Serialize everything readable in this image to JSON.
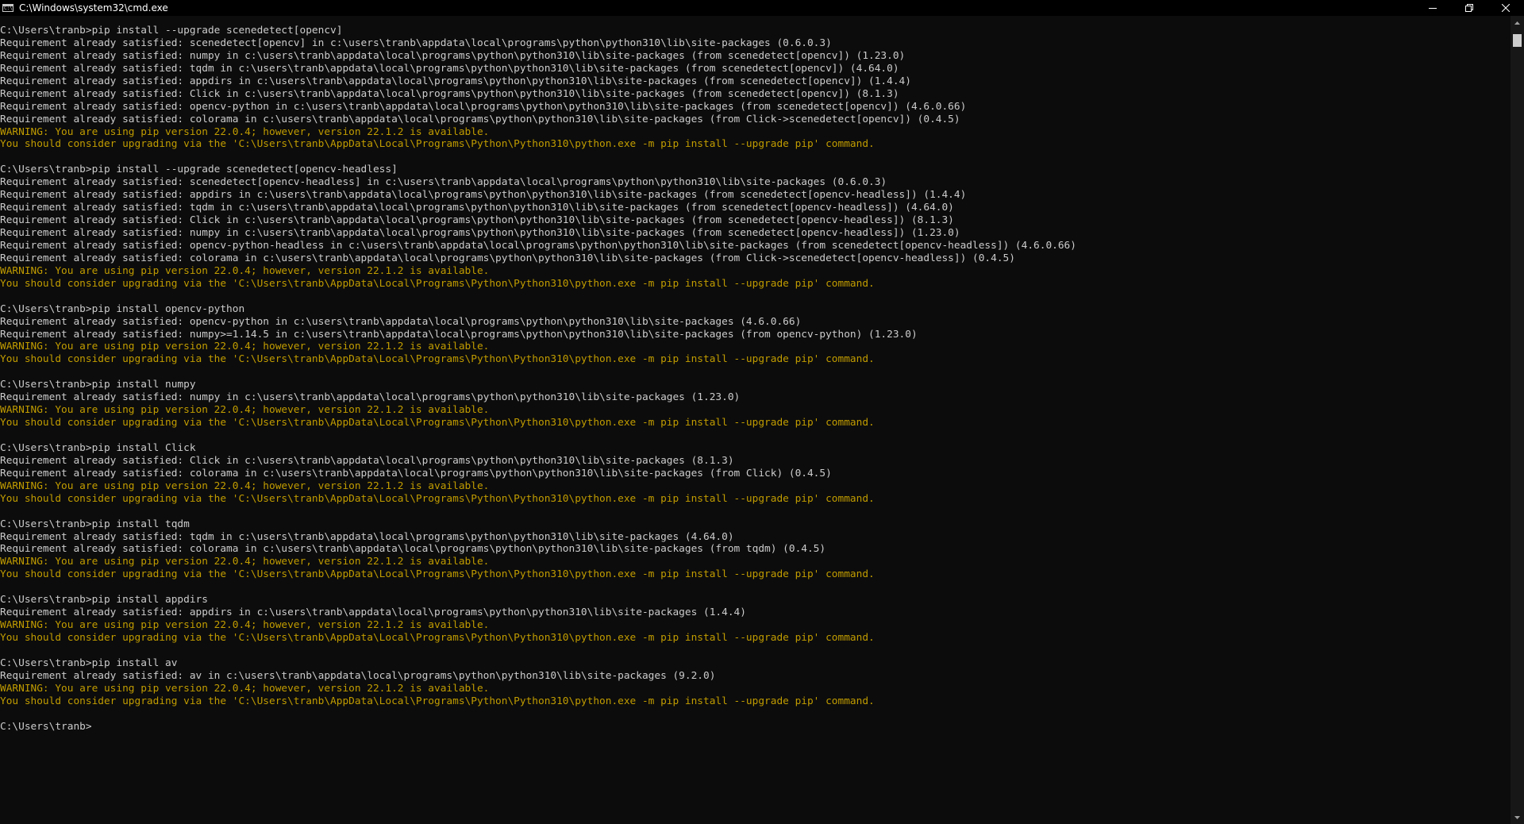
{
  "window": {
    "title": "C:\\Windows\\system32\\cmd.exe"
  },
  "colors": {
    "text": "#cccccc",
    "warning": "#c19c00",
    "background": "#0c0c0c"
  },
  "console": {
    "lines": [
      {
        "text": "C:\\Users\\tranb>pip install --upgrade scenedetect[opencv]",
        "type": "normal"
      },
      {
        "text": "Requirement already satisfied: scenedetect[opencv] in c:\\users\\tranb\\appdata\\local\\programs\\python\\python310\\lib\\site-packages (0.6.0.3)",
        "type": "normal"
      },
      {
        "text": "Requirement already satisfied: numpy in c:\\users\\tranb\\appdata\\local\\programs\\python\\python310\\lib\\site-packages (from scenedetect[opencv]) (1.23.0)",
        "type": "normal"
      },
      {
        "text": "Requirement already satisfied: tqdm in c:\\users\\tranb\\appdata\\local\\programs\\python\\python310\\lib\\site-packages (from scenedetect[opencv]) (4.64.0)",
        "type": "normal"
      },
      {
        "text": "Requirement already satisfied: appdirs in c:\\users\\tranb\\appdata\\local\\programs\\python\\python310\\lib\\site-packages (from scenedetect[opencv]) (1.4.4)",
        "type": "normal"
      },
      {
        "text": "Requirement already satisfied: Click in c:\\users\\tranb\\appdata\\local\\programs\\python\\python310\\lib\\site-packages (from scenedetect[opencv]) (8.1.3)",
        "type": "normal"
      },
      {
        "text": "Requirement already satisfied: opencv-python in c:\\users\\tranb\\appdata\\local\\programs\\python\\python310\\lib\\site-packages (from scenedetect[opencv]) (4.6.0.66)",
        "type": "normal"
      },
      {
        "text": "Requirement already satisfied: colorama in c:\\users\\tranb\\appdata\\local\\programs\\python\\python310\\lib\\site-packages (from Click->scenedetect[opencv]) (0.4.5)",
        "type": "normal"
      },
      {
        "text": "WARNING: You are using pip version 22.0.4; however, version 22.1.2 is available.",
        "type": "warn"
      },
      {
        "text": "You should consider upgrading via the 'C:\\Users\\tranb\\AppData\\Local\\Programs\\Python\\Python310\\python.exe -m pip install --upgrade pip' command.",
        "type": "warn"
      },
      {
        "text": "",
        "type": "normal"
      },
      {
        "text": "C:\\Users\\tranb>pip install --upgrade scenedetect[opencv-headless]",
        "type": "normal"
      },
      {
        "text": "Requirement already satisfied: scenedetect[opencv-headless] in c:\\users\\tranb\\appdata\\local\\programs\\python\\python310\\lib\\site-packages (0.6.0.3)",
        "type": "normal"
      },
      {
        "text": "Requirement already satisfied: appdirs in c:\\users\\tranb\\appdata\\local\\programs\\python\\python310\\lib\\site-packages (from scenedetect[opencv-headless]) (1.4.4)",
        "type": "normal"
      },
      {
        "text": "Requirement already satisfied: tqdm in c:\\users\\tranb\\appdata\\local\\programs\\python\\python310\\lib\\site-packages (from scenedetect[opencv-headless]) (4.64.0)",
        "type": "normal"
      },
      {
        "text": "Requirement already satisfied: Click in c:\\users\\tranb\\appdata\\local\\programs\\python\\python310\\lib\\site-packages (from scenedetect[opencv-headless]) (8.1.3)",
        "type": "normal"
      },
      {
        "text": "Requirement already satisfied: numpy in c:\\users\\tranb\\appdata\\local\\programs\\python\\python310\\lib\\site-packages (from scenedetect[opencv-headless]) (1.23.0)",
        "type": "normal"
      },
      {
        "text": "Requirement already satisfied: opencv-python-headless in c:\\users\\tranb\\appdata\\local\\programs\\python\\python310\\lib\\site-packages (from scenedetect[opencv-headless]) (4.6.0.66)",
        "type": "normal"
      },
      {
        "text": "Requirement already satisfied: colorama in c:\\users\\tranb\\appdata\\local\\programs\\python\\python310\\lib\\site-packages (from Click->scenedetect[opencv-headless]) (0.4.5)",
        "type": "normal"
      },
      {
        "text": "WARNING: You are using pip version 22.0.4; however, version 22.1.2 is available.",
        "type": "warn"
      },
      {
        "text": "You should consider upgrading via the 'C:\\Users\\tranb\\AppData\\Local\\Programs\\Python\\Python310\\python.exe -m pip install --upgrade pip' command.",
        "type": "warn"
      },
      {
        "text": "",
        "type": "normal"
      },
      {
        "text": "C:\\Users\\tranb>pip install opencv-python",
        "type": "normal"
      },
      {
        "text": "Requirement already satisfied: opencv-python in c:\\users\\tranb\\appdata\\local\\programs\\python\\python310\\lib\\site-packages (4.6.0.66)",
        "type": "normal"
      },
      {
        "text": "Requirement already satisfied: numpy>=1.14.5 in c:\\users\\tranb\\appdata\\local\\programs\\python\\python310\\lib\\site-packages (from opencv-python) (1.23.0)",
        "type": "normal"
      },
      {
        "text": "WARNING: You are using pip version 22.0.4; however, version 22.1.2 is available.",
        "type": "warn"
      },
      {
        "text": "You should consider upgrading via the 'C:\\Users\\tranb\\AppData\\Local\\Programs\\Python\\Python310\\python.exe -m pip install --upgrade pip' command.",
        "type": "warn"
      },
      {
        "text": "",
        "type": "normal"
      },
      {
        "text": "C:\\Users\\tranb>pip install numpy",
        "type": "normal"
      },
      {
        "text": "Requirement already satisfied: numpy in c:\\users\\tranb\\appdata\\local\\programs\\python\\python310\\lib\\site-packages (1.23.0)",
        "type": "normal"
      },
      {
        "text": "WARNING: You are using pip version 22.0.4; however, version 22.1.2 is available.",
        "type": "warn"
      },
      {
        "text": "You should consider upgrading via the 'C:\\Users\\tranb\\AppData\\Local\\Programs\\Python\\Python310\\python.exe -m pip install --upgrade pip' command.",
        "type": "warn"
      },
      {
        "text": "",
        "type": "normal"
      },
      {
        "text": "C:\\Users\\tranb>pip install Click",
        "type": "normal"
      },
      {
        "text": "Requirement already satisfied: Click in c:\\users\\tranb\\appdata\\local\\programs\\python\\python310\\lib\\site-packages (8.1.3)",
        "type": "normal"
      },
      {
        "text": "Requirement already satisfied: colorama in c:\\users\\tranb\\appdata\\local\\programs\\python\\python310\\lib\\site-packages (from Click) (0.4.5)",
        "type": "normal"
      },
      {
        "text": "WARNING: You are using pip version 22.0.4; however, version 22.1.2 is available.",
        "type": "warn"
      },
      {
        "text": "You should consider upgrading via the 'C:\\Users\\tranb\\AppData\\Local\\Programs\\Python\\Python310\\python.exe -m pip install --upgrade pip' command.",
        "type": "warn"
      },
      {
        "text": "",
        "type": "normal"
      },
      {
        "text": "C:\\Users\\tranb>pip install tqdm",
        "type": "normal"
      },
      {
        "text": "Requirement already satisfied: tqdm in c:\\users\\tranb\\appdata\\local\\programs\\python\\python310\\lib\\site-packages (4.64.0)",
        "type": "normal"
      },
      {
        "text": "Requirement already satisfied: colorama in c:\\users\\tranb\\appdata\\local\\programs\\python\\python310\\lib\\site-packages (from tqdm) (0.4.5)",
        "type": "normal"
      },
      {
        "text": "WARNING: You are using pip version 22.0.4; however, version 22.1.2 is available.",
        "type": "warn"
      },
      {
        "text": "You should consider upgrading via the 'C:\\Users\\tranb\\AppData\\Local\\Programs\\Python\\Python310\\python.exe -m pip install --upgrade pip' command.",
        "type": "warn"
      },
      {
        "text": "",
        "type": "normal"
      },
      {
        "text": "C:\\Users\\tranb>pip install appdirs",
        "type": "normal"
      },
      {
        "text": "Requirement already satisfied: appdirs in c:\\users\\tranb\\appdata\\local\\programs\\python\\python310\\lib\\site-packages (1.4.4)",
        "type": "normal"
      },
      {
        "text": "WARNING: You are using pip version 22.0.4; however, version 22.1.2 is available.",
        "type": "warn"
      },
      {
        "text": "You should consider upgrading via the 'C:\\Users\\tranb\\AppData\\Local\\Programs\\Python\\Python310\\python.exe -m pip install --upgrade pip' command.",
        "type": "warn"
      },
      {
        "text": "",
        "type": "normal"
      },
      {
        "text": "C:\\Users\\tranb>pip install av",
        "type": "normal"
      },
      {
        "text": "Requirement already satisfied: av in c:\\users\\tranb\\appdata\\local\\programs\\python\\python310\\lib\\site-packages (9.2.0)",
        "type": "normal"
      },
      {
        "text": "WARNING: You are using pip version 22.0.4; however, version 22.1.2 is available.",
        "type": "warn"
      },
      {
        "text": "You should consider upgrading via the 'C:\\Users\\tranb\\AppData\\Local\\Programs\\Python\\Python310\\python.exe -m pip install --upgrade pip' command.",
        "type": "warn"
      },
      {
        "text": "",
        "type": "normal"
      },
      {
        "text": "C:\\Users\\tranb>",
        "type": "normal"
      }
    ]
  },
  "icons": {
    "app": "cmd-icon",
    "minimize": "minimize-icon",
    "restore": "restore-icon",
    "close": "close-icon",
    "scroll_up": "scroll-up-arrow-icon",
    "scroll_down": "scroll-down-arrow-icon"
  }
}
